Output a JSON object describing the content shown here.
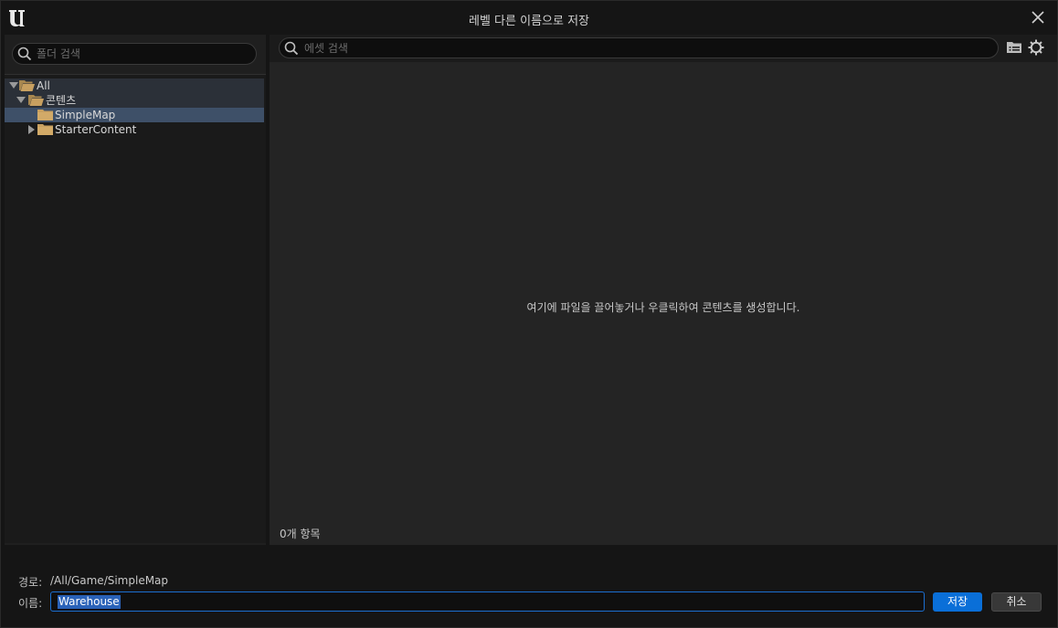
{
  "window": {
    "title": "레벨 다른 이름으로 저장"
  },
  "left_panel": {
    "search_placeholder": "폴더 검색",
    "tree": [
      {
        "label": "All",
        "expanded": true,
        "selected": false
      },
      {
        "label": "콘텐츠",
        "expanded": true,
        "selected": false
      },
      {
        "label": "SimpleMap",
        "expanded": false,
        "selected": true
      },
      {
        "label": "StarterContent",
        "expanded": false,
        "selected": false
      }
    ]
  },
  "right_panel": {
    "search_placeholder": "에셋 검색",
    "empty_hint": "여기에 파일을 끌어놓거나 우클릭하여 콘텐츠를 생성합니다.",
    "item_count": "0개 항목"
  },
  "bottom": {
    "path_label": "경로:",
    "path_value": "/All/Game/SimpleMap",
    "name_label": "이름:",
    "name_value": "Warehouse",
    "save_label": "저장",
    "cancel_label": "취소"
  },
  "colors": {
    "accent": "#0a6fd8",
    "selection": "#3e5068",
    "folder": "#c8a060"
  }
}
